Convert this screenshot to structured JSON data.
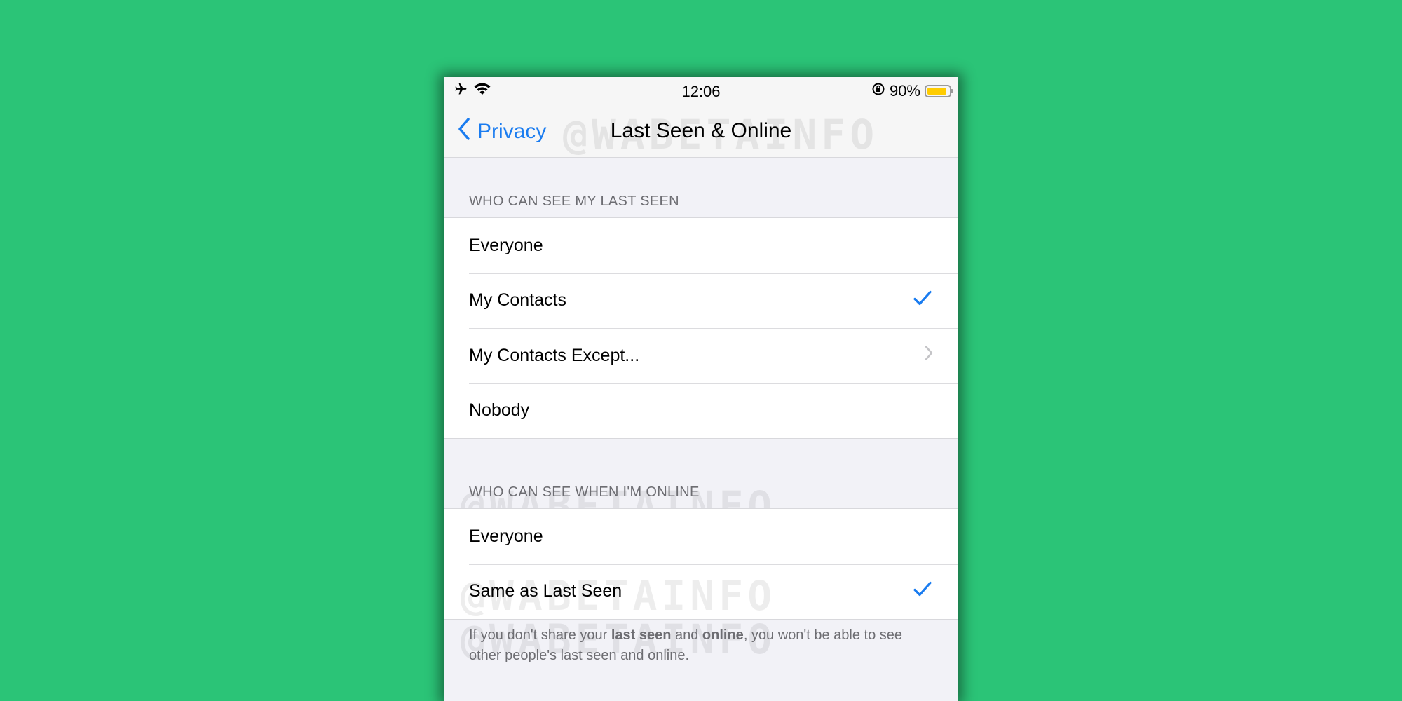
{
  "status_bar": {
    "time": "12:06",
    "battery_percent": "90%",
    "battery_level": 0.9,
    "icons": [
      "airplane-icon",
      "wifi-icon",
      "orientation-lock-icon",
      "battery-icon"
    ]
  },
  "nav": {
    "back_label": "Privacy",
    "title": "Last Seen & Online"
  },
  "watermark": "@WABETAINFO",
  "sections": [
    {
      "header": "WHO CAN SEE MY LAST SEEN",
      "options": [
        {
          "label": "Everyone",
          "accessory": "none"
        },
        {
          "label": "My Contacts",
          "accessory": "checkmark"
        },
        {
          "label": "My Contacts Except...",
          "accessory": "chevron"
        },
        {
          "label": "Nobody",
          "accessory": "none"
        }
      ]
    },
    {
      "header": "WHO CAN SEE WHEN I'M ONLINE",
      "options": [
        {
          "label": "Everyone",
          "accessory": "none"
        },
        {
          "label": "Same as Last Seen",
          "accessory": "checkmark"
        }
      ]
    }
  ],
  "footer": {
    "part1": "If you don't share your ",
    "bold1": "last seen",
    "part2": " and ",
    "bold2": "online",
    "part3": ", you won't be able to see other people's last seen and online."
  },
  "colors": {
    "background": "#2bc477",
    "accent": "#1a7cf0",
    "battery": "#ffcc00",
    "chevron": "#c4c4c7"
  }
}
